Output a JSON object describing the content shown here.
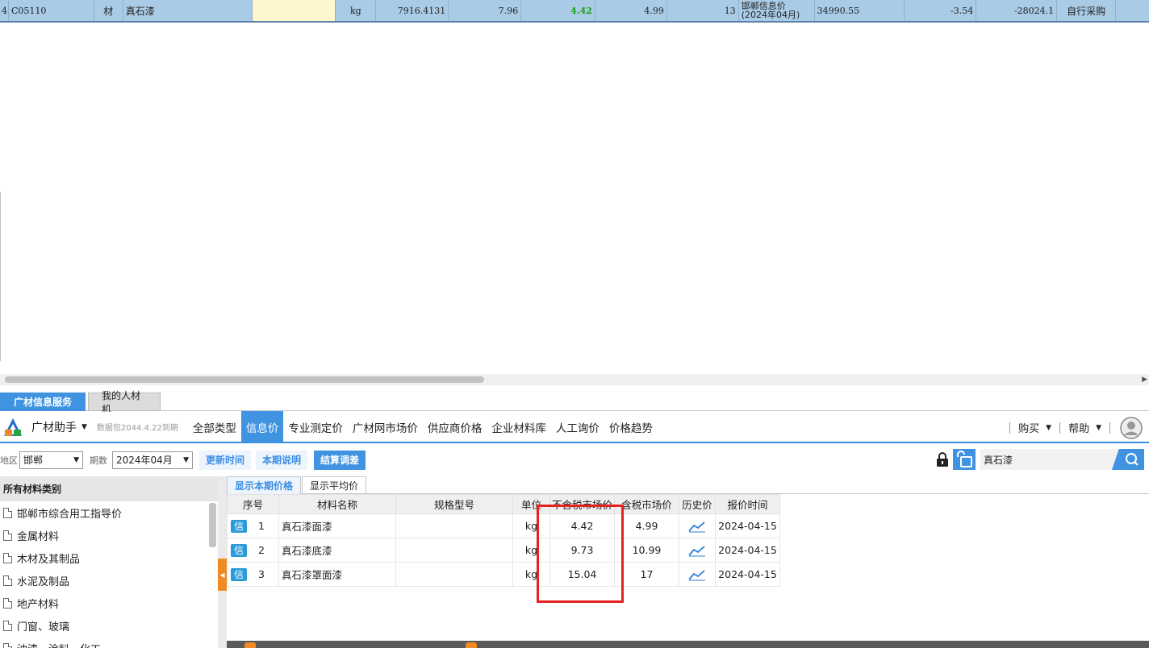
{
  "top_row": {
    "marker": "4",
    "code": "C05110",
    "type": "材",
    "name": "真石漆",
    "spec": "",
    "unit": "kg",
    "quantity": "7916.4131",
    "budget_price": "7.96",
    "market_price": "4.42",
    "tax_price": "4.99",
    "count": "13",
    "source_line1": "邯郸信息价",
    "source_line2": "(2024年04月)",
    "amount": "34990.55",
    "diff": "-3.54",
    "diff_total": "-28024.1",
    "supply": "自行采购"
  },
  "panel_tabs": [
    {
      "label": "广材信息服务",
      "active": true
    },
    {
      "label": "我的人材机",
      "active": false
    }
  ],
  "nav": {
    "brand": "广材助手",
    "version": "数据包2044.4.22到期",
    "items": [
      {
        "label": "全部类型",
        "active": false
      },
      {
        "label": "信息价",
        "active": true
      },
      {
        "label": "专业测定价",
        "active": false
      },
      {
        "label": "广材网市场价",
        "active": false
      },
      {
        "label": "供应商价格",
        "active": false
      },
      {
        "label": "企业材料库",
        "active": false
      },
      {
        "label": "人工询价",
        "active": false
      },
      {
        "label": "价格趋势",
        "active": false
      }
    ],
    "buy": "购买",
    "help": "帮助"
  },
  "filter": {
    "region_label": "地区",
    "region_value": "邯郸",
    "period_label": "期数",
    "period_value": "2024年04月",
    "btn_update_time": "更新时间",
    "btn_period_note": "本期说明",
    "btn_settle": "结算调差",
    "search_value": "真石漆"
  },
  "sidebar": {
    "header": "所有材料类别",
    "items": [
      "邯郸市综合用工指导价",
      "金属材料",
      "木材及其制品",
      "水泥及制品",
      "地产材料",
      "门窗、玻璃",
      "油漆、涂料、化工"
    ]
  },
  "results": {
    "tabs": [
      {
        "label": "显示本期价格",
        "active": true
      },
      {
        "label": "显示平均价",
        "active": false
      }
    ],
    "columns": [
      "序号",
      "材料名称",
      "规格型号",
      "单位",
      "不含税市场价",
      "含税市场价",
      "历史价",
      "报价时间"
    ],
    "badge": "信",
    "rows": [
      {
        "index": "1",
        "name": "真石漆面漆",
        "spec": "",
        "unit": "kg",
        "price_ex_tax": "4.42",
        "price_in_tax": "4.99",
        "date": "2024-04-15"
      },
      {
        "index": "2",
        "name": "真石漆底漆",
        "spec": "",
        "unit": "kg",
        "price_ex_tax": "9.73",
        "price_in_tax": "10.99",
        "date": "2024-04-15"
      },
      {
        "index": "3",
        "name": "真石漆罩面漆",
        "spec": "",
        "unit": "kg",
        "price_ex_tax": "15.04",
        "price_in_tax": "17",
        "date": "2024-04-15"
      }
    ]
  },
  "colors": {
    "accent": "#3f93e0",
    "highlight_box": "#e52222",
    "row_selected": "#a9cbe6",
    "price_green": "#17a317"
  }
}
